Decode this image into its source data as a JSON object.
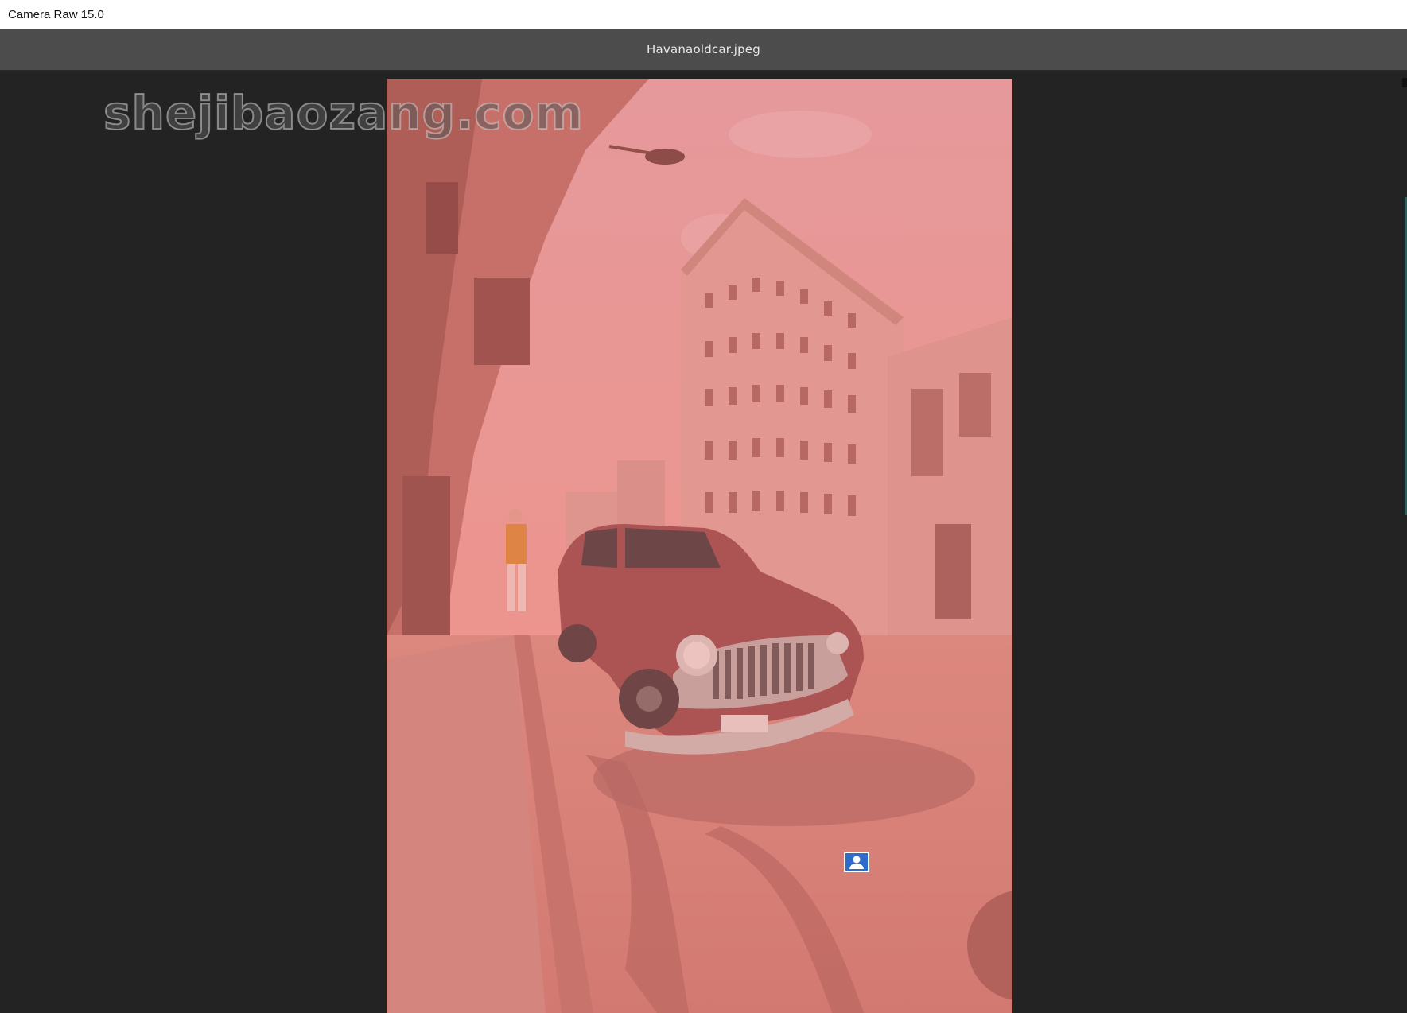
{
  "window": {
    "app_title": "Camera Raw 15.0"
  },
  "document": {
    "file_name": "Havanaoldcar.jpeg"
  },
  "watermark": {
    "text": "shejibaozang.com"
  },
  "canvas": {
    "overlay_color": "#e87b76",
    "background_color": "#232323"
  },
  "pins": {
    "mask_pin_icon": "person-icon"
  }
}
